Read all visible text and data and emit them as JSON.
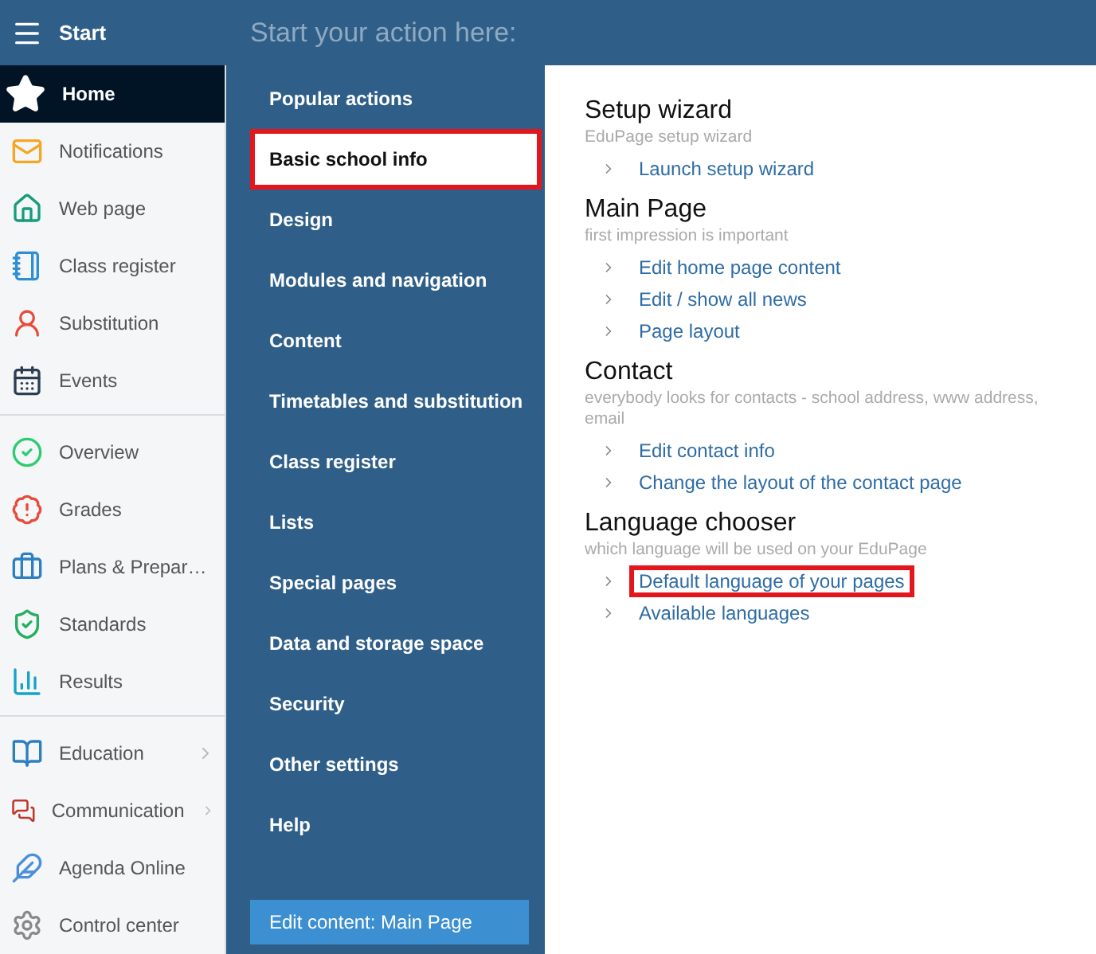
{
  "header": {
    "title": "Start",
    "prompt": "Start your action here:"
  },
  "sidebar": {
    "groups": [
      [
        {
          "label": "Home",
          "selected": true,
          "submenu": false
        },
        {
          "label": "Notifications",
          "selected": false,
          "submenu": false
        },
        {
          "label": "Web page",
          "selected": false,
          "submenu": false
        },
        {
          "label": "Class register",
          "selected": false,
          "submenu": false
        },
        {
          "label": "Substitution",
          "selected": false,
          "submenu": false
        },
        {
          "label": "Events",
          "selected": false,
          "submenu": false
        }
      ],
      [
        {
          "label": "Overview",
          "selected": false,
          "submenu": false
        },
        {
          "label": "Grades",
          "selected": false,
          "submenu": false
        },
        {
          "label": "Plans & Prepar…",
          "selected": false,
          "submenu": false
        },
        {
          "label": "Standards",
          "selected": false,
          "submenu": false
        },
        {
          "label": "Results",
          "selected": false,
          "submenu": false
        }
      ],
      [
        {
          "label": "Education",
          "selected": false,
          "submenu": true
        },
        {
          "label": "Communication",
          "selected": false,
          "submenu": true
        },
        {
          "label": "Agenda Online",
          "selected": false,
          "submenu": false
        },
        {
          "label": "Control center",
          "selected": false,
          "submenu": false
        }
      ]
    ]
  },
  "menu": {
    "items": [
      {
        "label": "Popular actions",
        "selected": false,
        "highlighted": false
      },
      {
        "label": "Basic school info",
        "selected": true,
        "highlighted": true
      },
      {
        "label": "Design",
        "selected": false,
        "highlighted": false
      },
      {
        "label": "Modules and navigation",
        "selected": false,
        "highlighted": false
      },
      {
        "label": "Content",
        "selected": false,
        "highlighted": false
      },
      {
        "label": "Timetables and substitution",
        "selected": false,
        "highlighted": false
      },
      {
        "label": "Class register",
        "selected": false,
        "highlighted": false
      },
      {
        "label": "Lists",
        "selected": false,
        "highlighted": false
      },
      {
        "label": "Special pages",
        "selected": false,
        "highlighted": false
      },
      {
        "label": "Data and storage space",
        "selected": false,
        "highlighted": false
      },
      {
        "label": "Security",
        "selected": false,
        "highlighted": false
      },
      {
        "label": "Other settings",
        "selected": false,
        "highlighted": false
      },
      {
        "label": "Help",
        "selected": false,
        "highlighted": false
      }
    ],
    "button": "Edit content: Main Page"
  },
  "sections": [
    {
      "title": "Setup wizard",
      "subtitle": "EduPage setup wizard",
      "links": [
        {
          "label": "Launch setup wizard",
          "highlighted": false
        }
      ]
    },
    {
      "title": "Main Page",
      "subtitle": "first impression is important",
      "links": [
        {
          "label": "Edit home page content",
          "highlighted": false
        },
        {
          "label": "Edit / show all news",
          "highlighted": false
        },
        {
          "label": "Page layout",
          "highlighted": false
        }
      ]
    },
    {
      "title": "Contact",
      "subtitle": "everybody looks for contacts - school address, www address, email",
      "links": [
        {
          "label": "Edit contact info",
          "highlighted": false
        },
        {
          "label": "Change the layout of the contact page",
          "highlighted": false
        }
      ]
    },
    {
      "title": "Language chooser",
      "subtitle": "which language will be used on your EduPage",
      "links": [
        {
          "label": "Default language of your pages",
          "highlighted": true
        },
        {
          "label": "Available languages",
          "highlighted": false
        }
      ]
    }
  ]
}
